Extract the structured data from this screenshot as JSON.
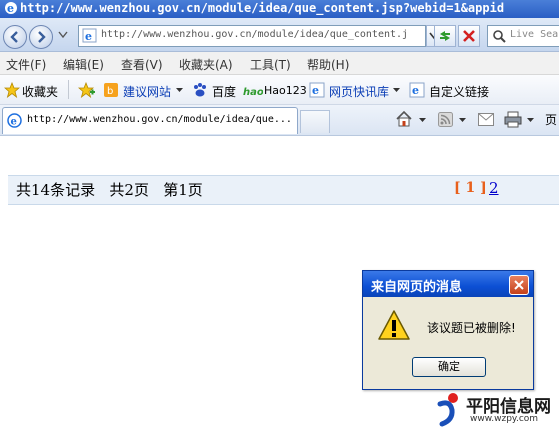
{
  "window": {
    "title_url": "http://www.wenzhou.gov.cn/module/idea/que_content.jsp?webid=1&appid"
  },
  "address_bar": {
    "url": "http://www.wenzhou.gov.cn/module/idea/que_content.j",
    "search_placeholder": "Live Sea"
  },
  "menu": {
    "items": [
      "文件(F)",
      "编辑(E)",
      "查看(V)",
      "收藏夹(A)",
      "工具(T)",
      "帮助(H)"
    ]
  },
  "favorites_bar": {
    "favorites_label": "收藏夹",
    "suggested_sites": "建议网站",
    "baidu": "百度",
    "hao123": "Hao123",
    "web_slice": "网页快讯库",
    "custom_links": "自定义链接"
  },
  "tab": {
    "label": "http://www.wenzhou.gov.cn/module/idea/que..."
  },
  "command_bar": {
    "page_label": "页"
  },
  "pager": {
    "records": "共14条记录",
    "pages": "共2页",
    "current": "第1页",
    "current_link": "[ 1 ]",
    "page2_link": "2"
  },
  "dialog": {
    "title": "来自网页的消息",
    "message": "该议题已被删除!",
    "ok_label": "确定"
  },
  "watermark": {
    "name": "平阳信息网",
    "url": "www.wzpy.com"
  },
  "colors": {
    "title_blue": "#2a5ec4",
    "pager_bg": "#eaf1f9",
    "pager_current": "#e8601c",
    "link_blue": "#0000cc",
    "dialog_title": "#0c4fd4"
  }
}
